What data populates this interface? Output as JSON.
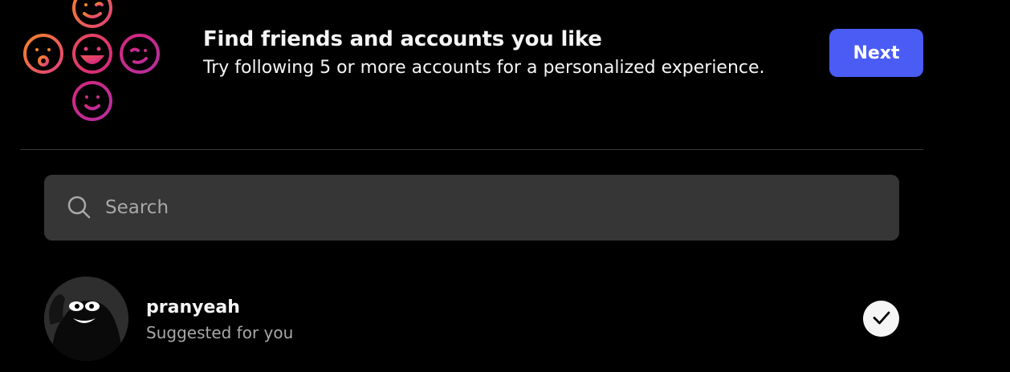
{
  "header": {
    "title": "Find friends and accounts you like",
    "subtitle": "Try following 5 or more accounts for a personalized experience.",
    "next_label": "Next",
    "illustration_icon": "emoji-cluster-icon"
  },
  "search": {
    "placeholder": "Search",
    "value": "",
    "icon": "search-icon"
  },
  "suggestions": [
    {
      "username": "pranyeah",
      "subtitle": "Suggested for you",
      "selected": true,
      "action_icon": "checkmark-icon"
    }
  ],
  "colors": {
    "background": "#000000",
    "primary_button": "#4a5cf4",
    "search_bg": "#363636",
    "divider": "#3a3a3a",
    "secondary_text": "#a8a8a8",
    "gradient_orange": "#f58529",
    "gradient_pink": "#dd2a7b",
    "gradient_purple": "#c13584"
  }
}
